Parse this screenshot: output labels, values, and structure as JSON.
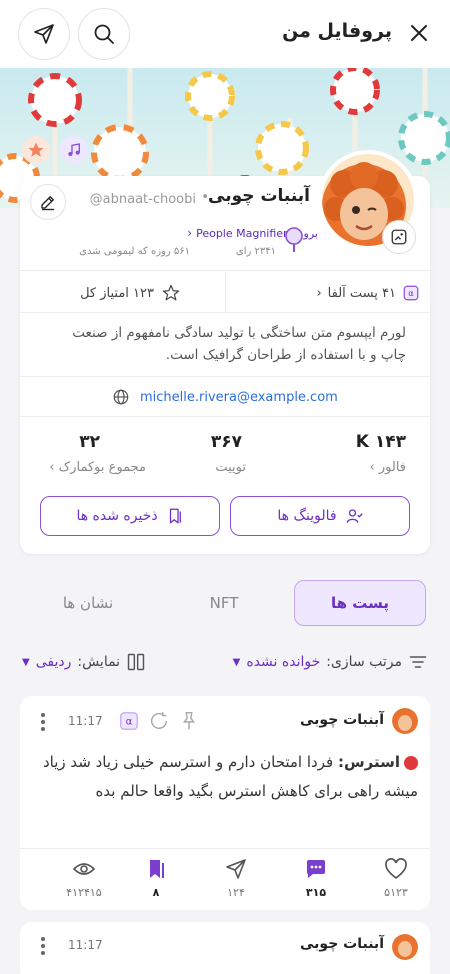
{
  "header": {
    "title": "پروفایل من"
  },
  "profile": {
    "name": "آبنبات چوبی",
    "handle": "@abnaat-choobi",
    "separator": "•",
    "rank_label": "۲۳۴۱ رای",
    "days_label": "۵۶۱ روزه که لیمومی شدی",
    "magnifier_link": "برو به People Magnifier",
    "alpha_posts": "۴۱ پست آلفا",
    "score": "۱۲۳ امتیاز کل",
    "bio": "لورم ایپسوم متن ساختگی با تولید سادگی نامفهوم از صنعت چاپ و با استفاده از طراحان گرافیک است.",
    "email": "michelle.rivera@example.com",
    "stats": [
      {
        "value": "۱۴۳ K",
        "label": "فالور ›"
      },
      {
        "value": "۳۶۷",
        "label": "توییت"
      },
      {
        "value": "۳۲",
        "label": "مجموع بوکمارک ›"
      }
    ],
    "following_btn": "فالوینگ ها",
    "saved_btn": "ذخیره شده ها"
  },
  "tabs": [
    {
      "label": "پست ها",
      "active": true
    },
    {
      "label": "NFT",
      "active": false
    },
    {
      "label": "نشان ها",
      "active": false
    }
  ],
  "sort": {
    "sort_label": "مرتب سازی:",
    "sort_value": "خوانده نشده",
    "view_label": "نمایش:",
    "view_value": "ردیفی"
  },
  "posts": [
    {
      "author": "آبنبات چوبی",
      "time": "11:17",
      "tag": "استرس:",
      "text": "فردا امتحان دارم و استرسم خیلی زیاد شد زیاد میشه راهی برای کاهش استرس بگید واقعا حالم بده",
      "likes": "۵۱۲۳",
      "comments": "۳۱۵",
      "shares": "۱۲۴",
      "bookmarks": "۸",
      "views": "۴۱۲۴۱۵"
    },
    {
      "author": "آبنبات چوبی",
      "time": "11:17"
    }
  ],
  "colors": {
    "accent": "#6b2fc4",
    "accent_light": "#efe6ff",
    "link": "#2a6fdb"
  }
}
